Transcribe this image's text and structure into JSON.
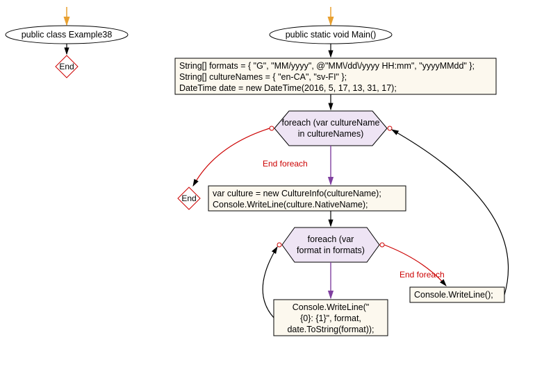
{
  "left": {
    "class_label": "public class Example38",
    "end": "End"
  },
  "right": {
    "main_label": "public static void Main()",
    "init_block": [
      "String[] formats = { \"G\", \"MM/yyyy\", @\"MM\\/dd\\/yyyy HH:mm\", \"yyyyMMdd\" };",
      "String[] cultureNames = { \"en-CA\", \"sv-FI\" };",
      "DateTime date = new DateTime(2016, 5, 17, 13, 31, 17);"
    ],
    "loop1": {
      "line1": "foreach (var cultureName",
      "line2": "in cultureNames)",
      "end_label": "End foreach"
    },
    "end": "End",
    "culture_block": [
      "var culture = new CultureInfo(cultureName);",
      "Console.WriteLine(culture.NativeName);"
    ],
    "loop2": {
      "line1": "foreach (var",
      "line2": "format in formats)",
      "end_label": "End foreach"
    },
    "write_block": [
      "Console.WriteLine(\"",
      "   {0}: {1}\", format,",
      "date.ToString(format));"
    ],
    "blank_write": "Console.WriteLine();"
  }
}
